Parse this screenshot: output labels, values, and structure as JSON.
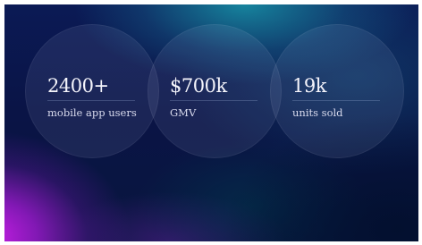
{
  "stats": [
    {
      "value": "2400+",
      "label": "mobile app users"
    },
    {
      "value": "$700k",
      "label": "GMV"
    },
    {
      "value": "19k",
      "label": "units sold"
    }
  ],
  "colors": {
    "background_deep": "#0a1446",
    "accent_teal": "#1896aa",
    "accent_magenta": "#c81ee6",
    "text_primary": "#f4f4fb"
  }
}
